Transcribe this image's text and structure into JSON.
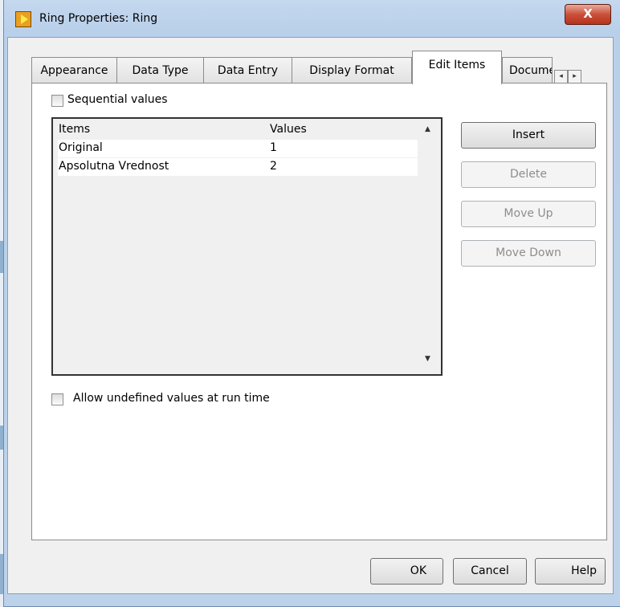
{
  "window": {
    "title": "Ring Properties: Ring",
    "close_label": "X"
  },
  "tabs": [
    {
      "label": "Appearance",
      "active": false
    },
    {
      "label": "Data Type",
      "active": false
    },
    {
      "label": "Data Entry",
      "active": false
    },
    {
      "label": "Display Format",
      "active": false
    },
    {
      "label": "Edit Items",
      "active": true
    },
    {
      "label": "Documentation",
      "active": false
    }
  ],
  "tab_scroll": {
    "left": "◂",
    "right": "▸"
  },
  "edit_items": {
    "sequential_values": {
      "label": "Sequential values",
      "checked": false
    },
    "table": {
      "headers": {
        "items": "Items",
        "values": "Values"
      },
      "rows": [
        {
          "item": "Original",
          "value": "1"
        },
        {
          "item": "Apsolutna Vrednost",
          "value": "2"
        }
      ],
      "scroll_up": "▲",
      "scroll_down": "▼"
    },
    "buttons": {
      "insert": "Insert",
      "delete": "Delete",
      "move_up": "Move Up",
      "move_down": "Move Down"
    },
    "allow_undefined": {
      "label": "Allow undefined values at run time",
      "checked": false
    }
  },
  "footer": {
    "ok": "OK",
    "cancel": "Cancel",
    "help": "Help"
  }
}
